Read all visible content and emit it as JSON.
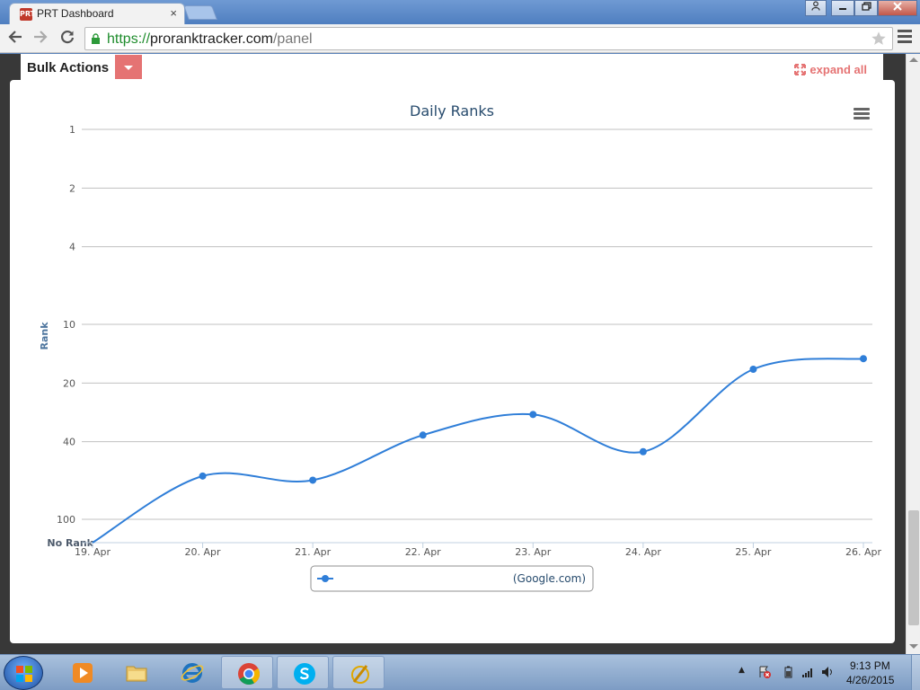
{
  "browser": {
    "tab_title": "PRT Dashboard",
    "tab_close": "×",
    "favicon_text": "PRT",
    "url_scheme": "https://",
    "url_host": "proranktracker.com",
    "url_path": "/panel"
  },
  "toolbar": {
    "bulk_actions_label": "Bulk Actions",
    "expand_all_label": "expand all",
    "accent_color": "#e57373"
  },
  "chart_data": {
    "type": "line",
    "title": "Daily Ranks",
    "ylabel": "Rank",
    "y_scale": "log, inverted",
    "y_ticks": [
      "1",
      "2",
      "4",
      "10",
      "20",
      "40",
      "100",
      "No Rank"
    ],
    "categories": [
      "19. Apr",
      "20. Apr",
      "21. Apr",
      "22. Apr",
      "23. Apr",
      "24. Apr",
      "25. Apr",
      "26. Apr"
    ],
    "series": [
      {
        "name": "(Google.com)",
        "color": "#2f7ed8",
        "values": [
          "No Rank",
          60,
          63,
          37,
          29,
          45,
          17,
          15
        ]
      }
    ],
    "grid": true,
    "legend_position": "bottom-center"
  },
  "taskbar": {
    "time": "9:13 PM",
    "date": "4/26/2015",
    "tray_arrow": "▲"
  }
}
